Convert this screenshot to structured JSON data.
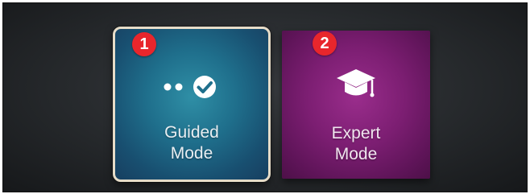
{
  "modes": [
    {
      "badge": "1",
      "line1": "Guided",
      "line2": "Mode",
      "icon": "guided-steps-check-icon",
      "selected": true,
      "color": "#1f6f8c"
    },
    {
      "badge": "2",
      "line1": "Expert",
      "line2": "Mode",
      "icon": "graduation-cap-icon",
      "selected": false,
      "color": "#7c1e72"
    }
  ],
  "colors": {
    "badge": "#e8262c",
    "selected_border": "#e6dcc8",
    "background": "#26292c"
  }
}
